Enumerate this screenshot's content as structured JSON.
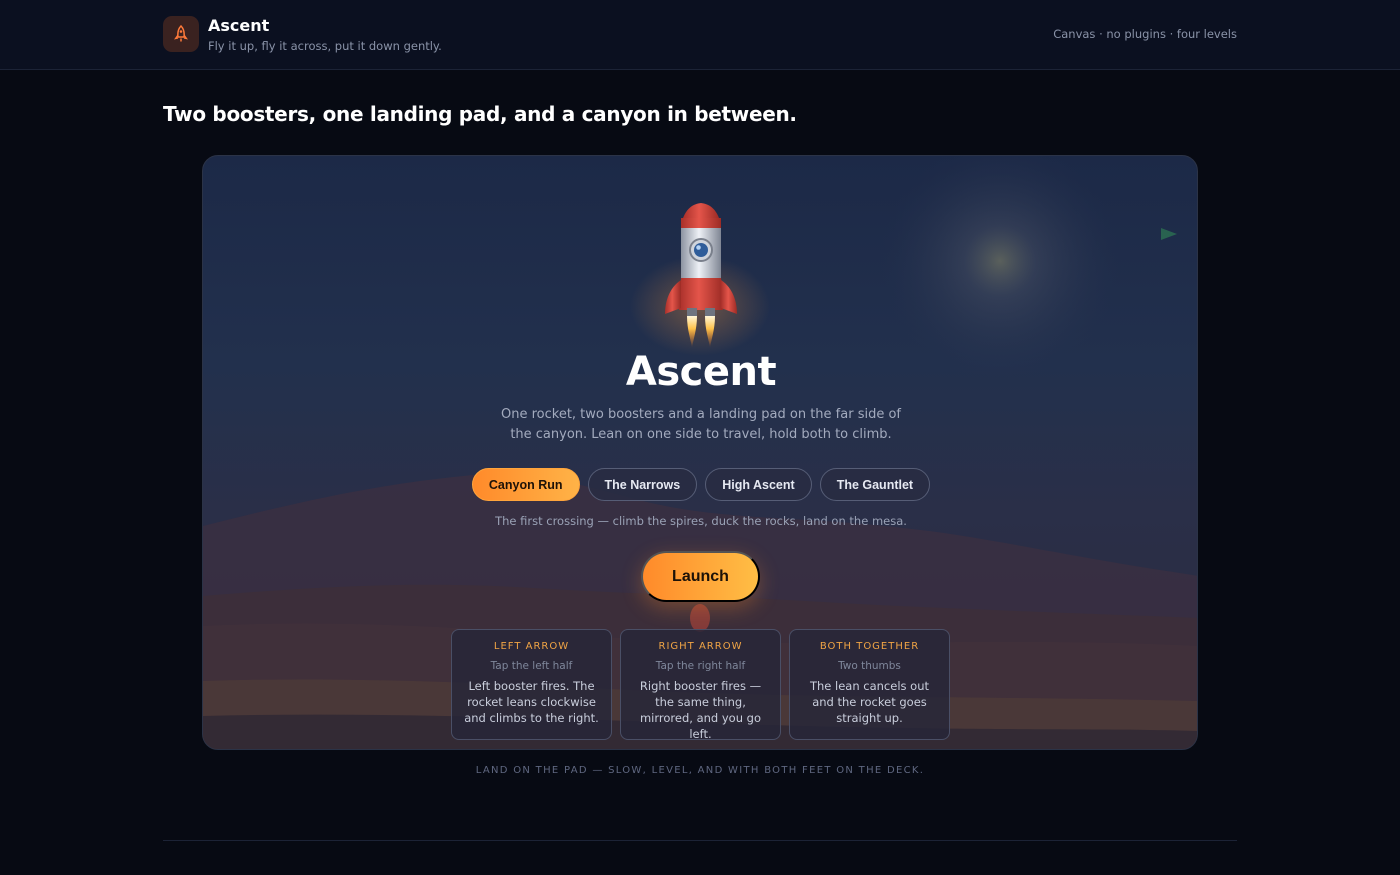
{
  "header": {
    "app_name": "Ascent",
    "tagline": "Fly it up, fly it across, put it down gently.",
    "meta": "Canvas · no plugins · four levels"
  },
  "headline": "Two boosters, one landing pad, and a canyon in between.",
  "game": {
    "title": "Ascent",
    "description": "One rocket, two boosters and a landing pad on the far side of the canyon. Lean on one side to travel, hold both to climb.",
    "levels": [
      {
        "label": "Canyon Run",
        "active": true
      },
      {
        "label": "The Narrows",
        "active": false
      },
      {
        "label": "High Ascent",
        "active": false
      },
      {
        "label": "The Gauntlet",
        "active": false
      }
    ],
    "level_description": "The first crossing — climb the spires, duck the rocks, land on the mesa.",
    "launch_label": "Launch",
    "controls": [
      {
        "key": "LEFT ARROW",
        "touch": "Tap the left half",
        "text": "Left booster fires. The rocket leans clockwise and climbs to the right."
      },
      {
        "key": "RIGHT ARROW",
        "touch": "Tap the right half",
        "text": "Right booster fires — the same thing, mirrored, and you go left."
      },
      {
        "key": "BOTH TOGETHER",
        "touch": "Two thumbs",
        "text": "The lean cancels out and the rocket goes straight up."
      }
    ]
  },
  "footer_note": "LAND ON THE PAD — SLOW, LEVEL, AND WITH BOTH FEET ON THE DECK.",
  "colors": {
    "accent": "#ff9a33",
    "background": "#070a13",
    "header": "#0b1020"
  },
  "icons": {
    "brand": "rocket-icon"
  }
}
